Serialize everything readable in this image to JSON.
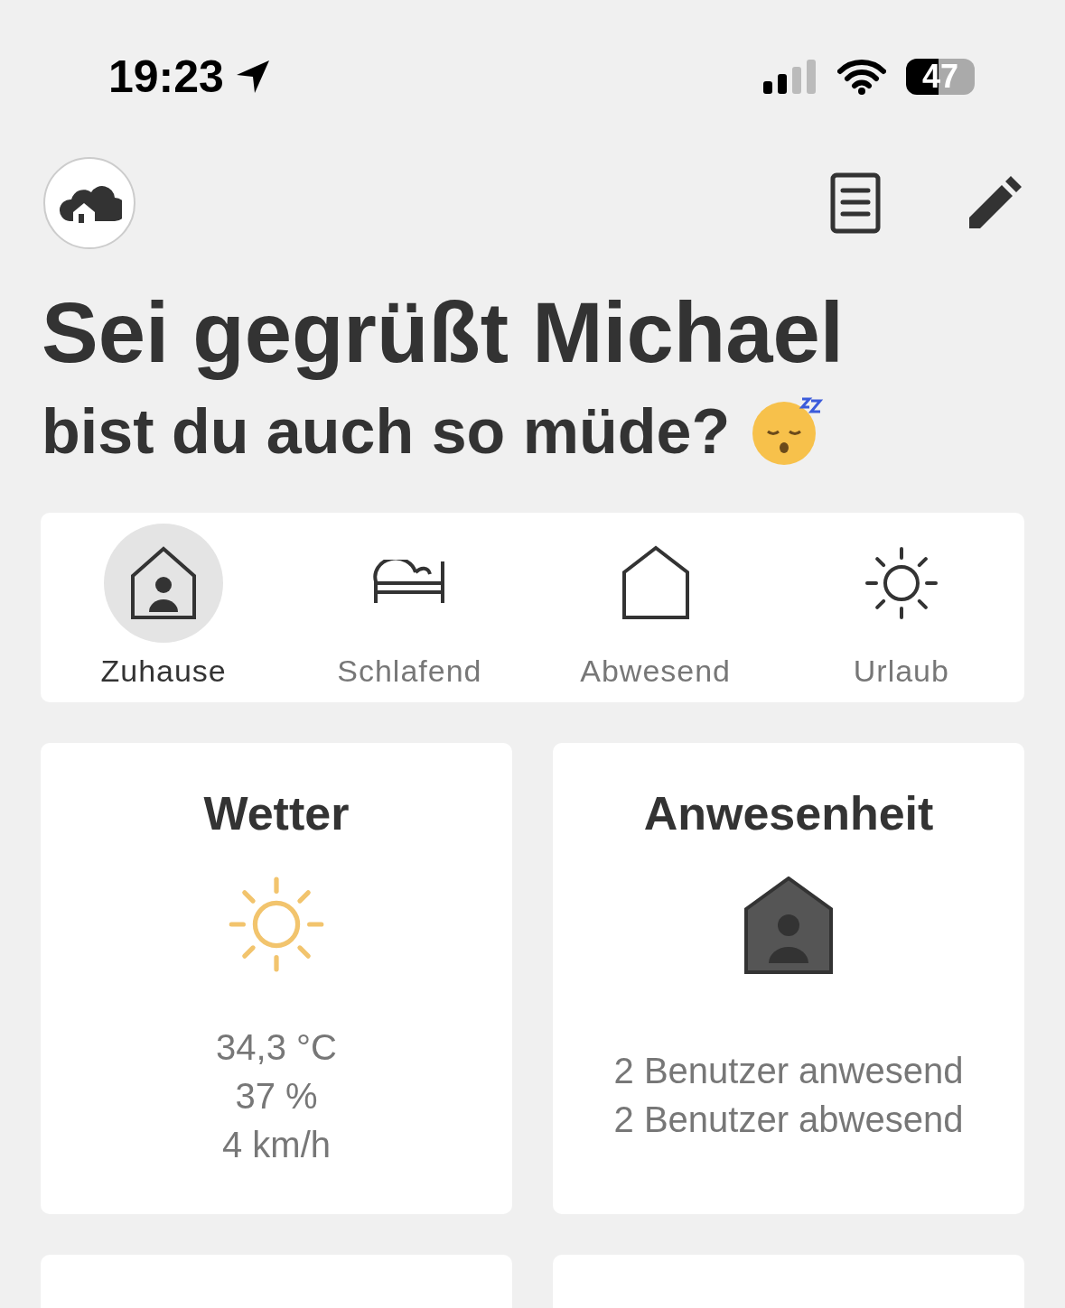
{
  "status_bar": {
    "time": "19:23",
    "battery": "47"
  },
  "greeting": {
    "title": "Sei gegrüßt Michael",
    "subtitle": "bist du auch so müde?"
  },
  "modes": [
    {
      "label": "Zuhause",
      "kind": "home",
      "selected": true
    },
    {
      "label": "Schlafend",
      "kind": "bed",
      "selected": false
    },
    {
      "label": "Abwesend",
      "kind": "house",
      "selected": false
    },
    {
      "label": "Urlaub",
      "kind": "sun",
      "selected": false
    }
  ],
  "tiles": [
    {
      "kind": "weather",
      "title": "Wetter",
      "lines": [
        "34,3 °C",
        "37 %",
        "4 km/h"
      ]
    },
    {
      "kind": "presence",
      "title": "Anwesenheit",
      "lines": [
        "2 Benutzer anwesend",
        "2 Benutzer abwesend"
      ]
    },
    {
      "kind": "empty"
    },
    {
      "kind": "empty"
    }
  ]
}
